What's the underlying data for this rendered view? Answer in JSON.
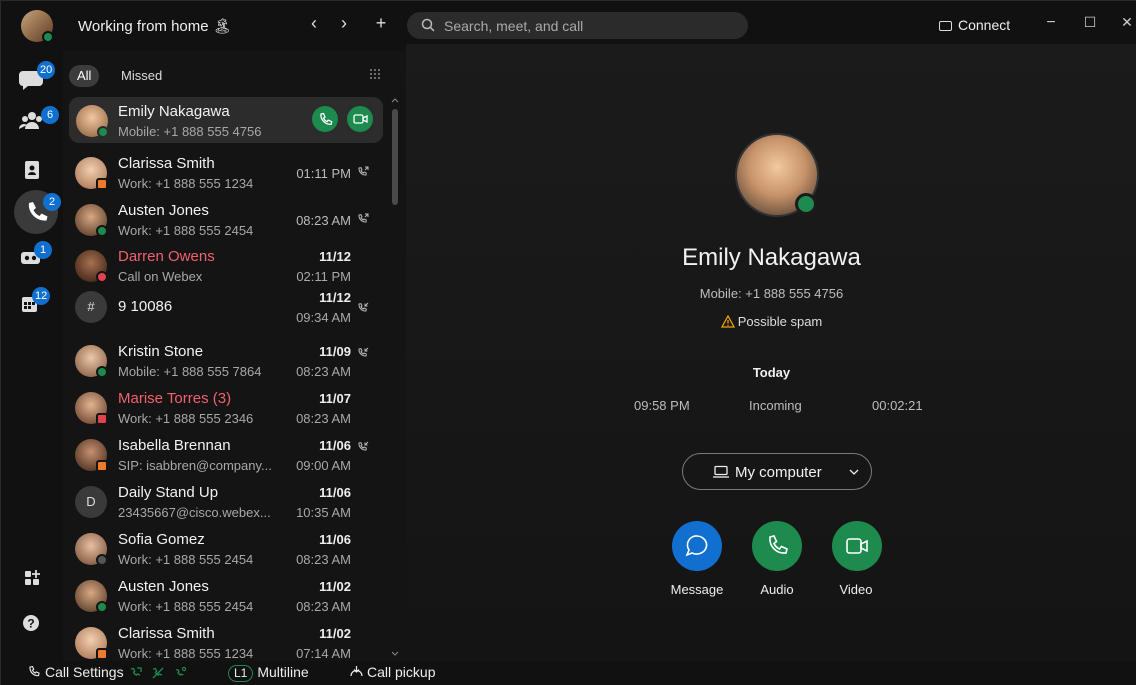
{
  "titlebar": {
    "title": "Working from home 🏝",
    "back_label": "‹",
    "forward_label": "›",
    "new_label": "+",
    "search_placeholder": "Search, meet, and call",
    "connect_label": "Connect",
    "minimize": "−",
    "maximize": "☐",
    "close": "✕"
  },
  "rail": {
    "badges": {
      "messaging": "20",
      "teams": "6",
      "calling": "2",
      "voicemail": "1",
      "meetings": "12"
    }
  },
  "filters": {
    "all": "All",
    "missed": "Missed"
  },
  "calls": [
    {
      "name": "Emily Nakagawa",
      "sub": "Mobile: +1 888 555 4756",
      "date": "",
      "time": "",
      "missed": false
    },
    {
      "name": "Clarissa Smith",
      "sub": "Work: +1 888 555 1234",
      "date": "",
      "time": "01:11 PM",
      "missed": false
    },
    {
      "name": "Austen Jones",
      "sub": "Work: +1 888 555 2454",
      "date": "",
      "time": "08:23 AM",
      "missed": false
    },
    {
      "name": "Darren Owens",
      "sub": "Call on Webex",
      "date": "11/12",
      "time": "02:11 PM",
      "missed": true
    },
    {
      "name": "9 10086",
      "sub": "",
      "date": "11/12",
      "time": "09:34 AM",
      "missed": false,
      "avatar_text": "#"
    },
    {
      "name": "Kristin Stone",
      "sub": "Mobile: +1 888 555 7864",
      "date": "11/09",
      "time": "08:23 AM",
      "missed": false
    },
    {
      "name": "Marise Torres (3)",
      "sub": "Work: +1 888 555 2346",
      "date": "11/07",
      "time": "08:23 AM",
      "missed": true
    },
    {
      "name": "Isabella Brennan",
      "sub": "SIP: isabbren@company...",
      "date": "11/06",
      "time": "09:00 AM",
      "missed": false
    },
    {
      "name": "Daily Stand Up",
      "sub": "23435667@cisco.webex...",
      "date": "11/06",
      "time": "10:35 AM",
      "missed": false,
      "avatar_text": "D"
    },
    {
      "name": "Sofia Gomez",
      "sub": "Work: +1 888 555 2454",
      "date": "11/06",
      "time": "08:23 AM",
      "missed": false
    },
    {
      "name": "Austen Jones",
      "sub": "Work: +1 888 555 2454",
      "date": "11/02",
      "time": "08:23 AM",
      "missed": false
    },
    {
      "name": "Clarissa Smith",
      "sub": "Work: +1 888 555 1234",
      "date": "11/02",
      "time": "07:14 AM",
      "missed": false
    }
  ],
  "statusbar": {
    "call_settings": "Call Settings",
    "line_badge": "L1",
    "multiline": "Multiline",
    "call_pickup": "Call pickup"
  },
  "detail": {
    "name": "Emily Nakagawa",
    "phone": "Mobile: +1 888 555 4756",
    "spam": "Possible spam",
    "section": "Today",
    "history": {
      "time": "09:58 PM",
      "direction": "Incoming",
      "duration": "00:02:21"
    },
    "device": "My computer",
    "actions": {
      "message": "Message",
      "audio": "Audio",
      "video": "Video"
    }
  },
  "colors": {
    "green": "#1d8a4e",
    "blue": "#1170cf",
    "missed_red": "#f0616e",
    "warning": "#f0a30a"
  }
}
